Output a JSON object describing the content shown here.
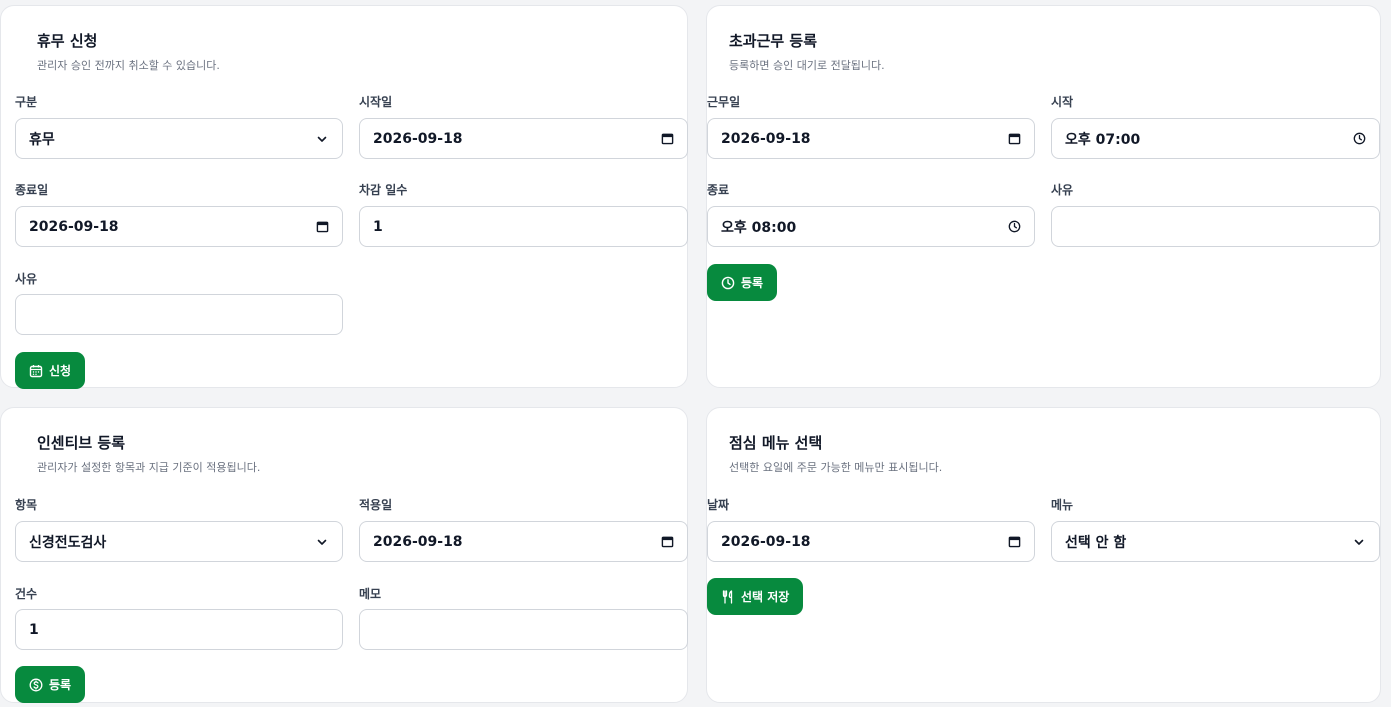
{
  "leave": {
    "title": "휴무 신청",
    "subtitle": "관리자 승인 전까지 취소할 수 있습니다.",
    "type_label": "구분",
    "type_value": "휴무",
    "start_label": "시작일",
    "start_value": "2026-09-18",
    "end_label": "종료일",
    "end_value": "2026-09-18",
    "days_label": "차감 일수",
    "days_value": "1",
    "reason_label": "사유",
    "reason_value": "",
    "submit_label": "신청"
  },
  "overtime": {
    "title": "초과근무 등록",
    "subtitle": "등록하면 승인 대기로 전달됩니다.",
    "date_label": "근무일",
    "date_value": "2026-09-18",
    "start_label": "시작",
    "start_value": "오후 07:00",
    "end_label": "종료",
    "end_value": "오후 08:00",
    "reason_label": "사유",
    "reason_value": "",
    "submit_label": "등록"
  },
  "incentive": {
    "title": "인센티브 등록",
    "subtitle": "관리자가 설정한 항목과 지급 기준이 적용됩니다.",
    "item_label": "항목",
    "item_value": "신경전도검사",
    "date_label": "적용일",
    "date_value": "2026-09-18",
    "count_label": "건수",
    "count_value": "1",
    "memo_label": "메모",
    "memo_value": "",
    "submit_label": "등록"
  },
  "lunch": {
    "title": "점심 메뉴 선택",
    "subtitle": "선택한 요일에 주문 가능한 메뉴만 표시됩니다.",
    "date_label": "날짜",
    "date_value": "2026-09-18",
    "menu_label": "메뉴",
    "menu_value": "선택 안 함",
    "submit_label": "선택 저장"
  },
  "colors": {
    "accent": "#078a3e",
    "border": "#d1d5db",
    "background": "#f3f4f6"
  },
  "icons": {
    "select": "chevron-down-icon",
    "date": "calendar-icon",
    "time": "clock-icon",
    "leave_submit": "calendar-icon",
    "overtime_submit": "clock-icon",
    "incentive_submit": "dollar-icon",
    "lunch_submit": "utensils-icon"
  }
}
